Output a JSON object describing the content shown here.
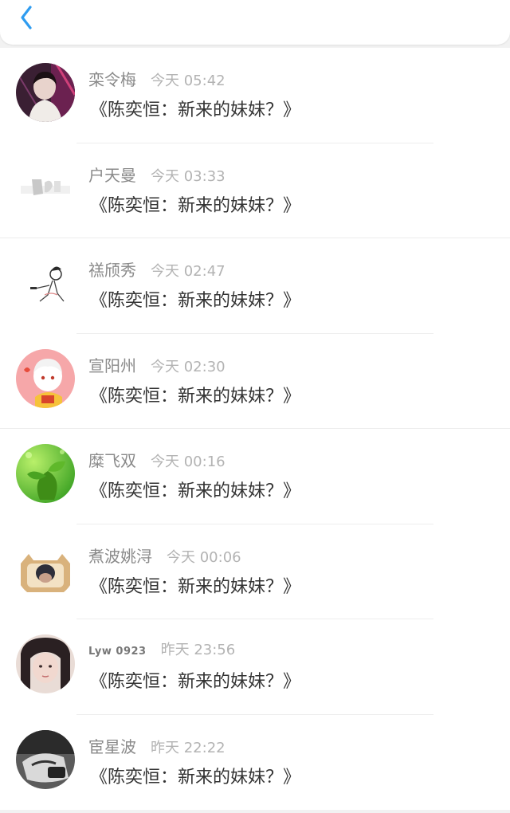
{
  "header": {
    "back_icon": "chevron-left-icon",
    "accent_color": "#2f9cf0"
  },
  "items": [
    {
      "name": "栾令梅",
      "time": "今天 05:42",
      "title": "《陈奕恒：新来的妹妹？》"
    },
    {
      "name": "户天曼",
      "time": "今天 03:33",
      "title": "《陈奕恒：新来的妹妹？》"
    },
    {
      "name": "禚颀秀",
      "time": "今天 02:47",
      "title": "《陈奕恒：新来的妹妹？》"
    },
    {
      "name": "宣阳州",
      "time": "今天 02:30",
      "title": "《陈奕恒：新来的妹妹？》"
    },
    {
      "name": "糜飞双",
      "time": "今天 00:16",
      "title": "《陈奕恒：新来的妹妹？》"
    },
    {
      "name": "煮波姚浔",
      "time": "今天 00:06",
      "title": "《陈奕恒：新来的妹妹？》"
    },
    {
      "name": "Lyw 0923",
      "time": "昨天 23:56",
      "title": "《陈奕恒：新来的妹妹？》"
    },
    {
      "name": "宦星波",
      "time": "昨天 22:22",
      "title": "《陈奕恒：新来的妹妹？》"
    }
  ]
}
